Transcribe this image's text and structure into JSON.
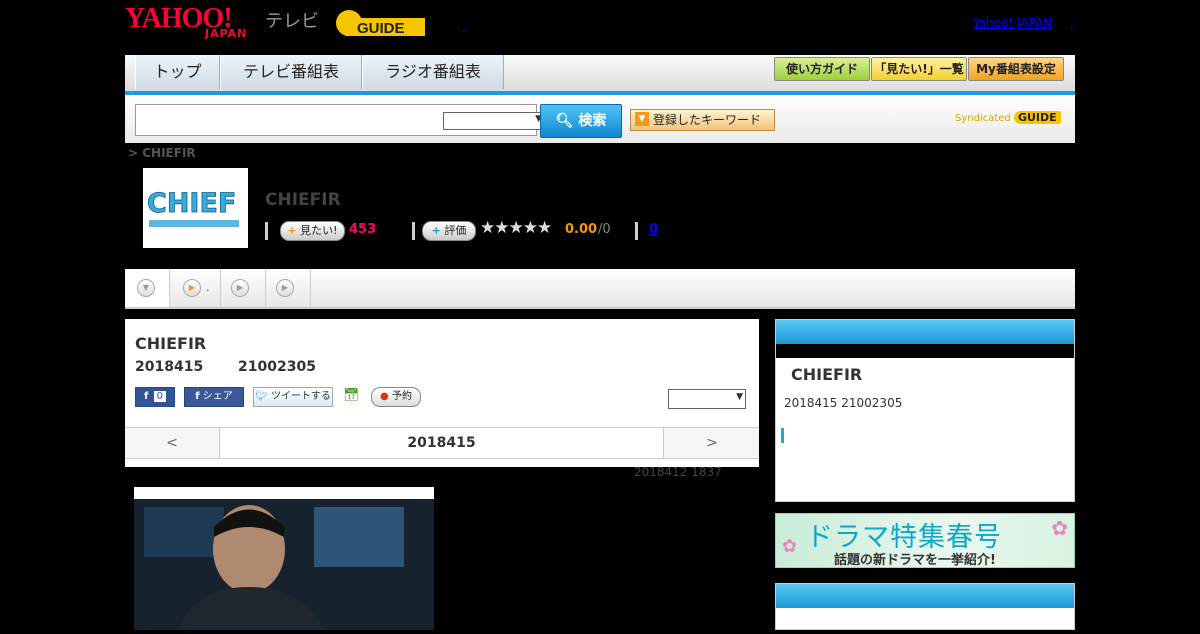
{
  "header": {
    "yahoo_logo": "YAHOO!",
    "japan_logo": "JAPAN",
    "tv_label": "テレビ",
    "gguide_logo": "GUIDE",
    "yahoo_japan_link": "Yahoo! JAPAN",
    "separator": ","
  },
  "nav": {
    "tabs": [
      "トップ",
      "テレビ番組表",
      "ラジオ番組表"
    ],
    "buttons": [
      "使い方ガイド",
      "「見たい!」一覧",
      "My番組表設定"
    ]
  },
  "search": {
    "input_value": "",
    "select_value": "",
    "search_button": "検索",
    "keyword_button": "登録したキーワード",
    "syndicated": "Syndicated",
    "syndicated_logo": "GUIDE"
  },
  "breadcrumb": "> CHIEFIR",
  "program": {
    "thumb_text": "CHIEF",
    "title": "CHIEFIR",
    "want_label": "見たい!",
    "want_count": "453",
    "rate_label": "評価",
    "stars": "★★★★★",
    "rating": "0.00",
    "rating_count": "/0",
    "review_count": "0"
  },
  "subtabs": {
    "second_label": "."
  },
  "main": {
    "title": "CHIEFIR",
    "date": "2018415",
    "time": "21002305",
    "like_count": "0",
    "share_label": "シェア",
    "tweet_label": "ツイートする",
    "reserve_label": "予約",
    "select_value": "",
    "prev": "<",
    "current_date": "2018415",
    "next": ">",
    "updated": "2018412  1837"
  },
  "side": {
    "title": "CHIEFIR",
    "info": "2018415  21002305",
    "banner_title": "ドラマ特集春号",
    "banner_sub": "話題の新ドラマを一挙紹介!"
  },
  "colors": {
    "accent": "#1b9be0",
    "want": "#ff0066",
    "rating": "#f29a00",
    "logo": "#ff0033"
  }
}
